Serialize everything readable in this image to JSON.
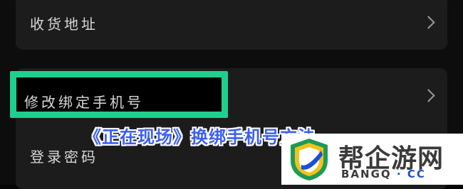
{
  "settings": {
    "items": [
      {
        "label": "收货地址",
        "has_chevron": true,
        "icon": "chevron-right-icon"
      },
      {
        "label": "修改绑定手机号",
        "has_chevron": true,
        "icon": "chevron-right-icon"
      },
      {
        "label": "登录密码",
        "has_chevron": false
      }
    ]
  },
  "overlay": {
    "caption": "《正在现场》换绑手机号方法",
    "highlight_color": "#1fcf8d",
    "caption_color": "#3c5ff2"
  },
  "watermark": {
    "title": "帮企游网",
    "sub_left": "BANGQ",
    "sub_sep": "·",
    "sub_right": "CC"
  }
}
